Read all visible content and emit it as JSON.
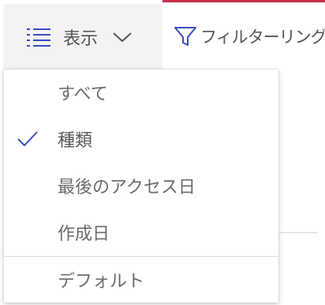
{
  "toolbar": {
    "view_button": {
      "label": "表示",
      "icon": "list-view-icon",
      "dropdown_icon": "chevron-down-icon",
      "expanded": true
    },
    "filter_button": {
      "label": "フィルターリング",
      "icon": "filter-icon"
    }
  },
  "view_menu": {
    "items": [
      {
        "label": "すべて",
        "selected": false
      },
      {
        "label": "種類",
        "selected": true
      },
      {
        "label": "最後のアクセス日",
        "selected": false
      },
      {
        "label": "作成日",
        "selected": false
      }
    ],
    "default_item": {
      "label": "デフォルト"
    },
    "check_icon": "checkmark-icon"
  },
  "colors": {
    "accent": "#3b4cc0",
    "top_accent": "#c4314b",
    "text": "#6b6b6b",
    "button_bg": "#f3f3f3"
  }
}
